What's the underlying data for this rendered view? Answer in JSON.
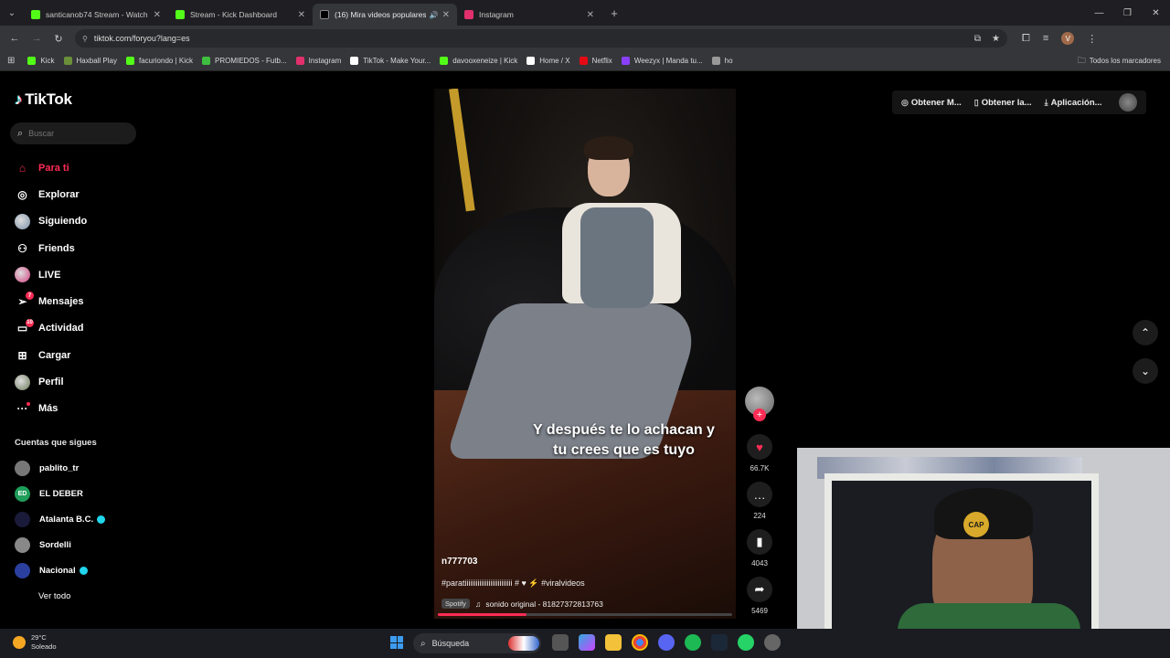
{
  "browser": {
    "tabs": [
      {
        "title": "santicanob74 Stream - Watch L",
        "color": "#53fc18",
        "active": false
      },
      {
        "title": "Stream - Kick Dashboard",
        "color": "#53fc18",
        "active": false
      },
      {
        "title": "(16) Mira videos populares",
        "color": "#ffffff",
        "active": true
      },
      {
        "title": "Instagram",
        "color": "#e1306c",
        "active": false
      }
    ],
    "url": "tiktok.com/foryou?lang=es",
    "bookmarks": [
      {
        "label": "Kick",
        "color": "#53fc18"
      },
      {
        "label": "Haxball Play",
        "color": "#6b8f3a"
      },
      {
        "label": "facuriondo | Kick",
        "color": "#53fc18"
      },
      {
        "label": "PROMIEDOS - Futb...",
        "color": "#3fbf3f"
      },
      {
        "label": "Instagram",
        "color": "#e1306c"
      },
      {
        "label": "TikTok - Make Your...",
        "color": "#ffffff"
      },
      {
        "label": "davooxeneize | Kick",
        "color": "#53fc18"
      },
      {
        "label": "Home / X",
        "color": "#ffffff"
      },
      {
        "label": "Netflix",
        "color": "#e50914"
      },
      {
        "label": "Weezyx | Manda tu...",
        "color": "#8a3ffc"
      },
      {
        "label": "ho",
        "color": "#999999"
      }
    ],
    "all_bookmarks": "Todos los marcadores"
  },
  "tiktok": {
    "logo": "TikTok",
    "search_placeholder": "Buscar",
    "menu": [
      {
        "label": "Para ti",
        "icon": "home-icon",
        "active": true
      },
      {
        "label": "Explorar",
        "icon": "compass-icon"
      },
      {
        "label": "Siguiendo",
        "icon": "avatar"
      },
      {
        "label": "Friends",
        "icon": "friends-icon"
      },
      {
        "label": "LIVE",
        "icon": "avatar"
      },
      {
        "label": "Mensajes",
        "icon": "send-icon",
        "badge": "7"
      },
      {
        "label": "Actividad",
        "icon": "inbox-icon",
        "badge": "10"
      },
      {
        "label": "Cargar",
        "icon": "upload-icon"
      },
      {
        "label": "Perfil",
        "icon": "avatar"
      },
      {
        "label": "Más",
        "icon": "more-icon",
        "dot": true
      }
    ],
    "following_title": "Cuentas que sigues",
    "following": [
      {
        "name": "pablito_tr",
        "verified": false,
        "color": "#777777",
        "initials": ""
      },
      {
        "name": "EL DEBER",
        "verified": false,
        "color": "#1e9e5a",
        "initials": "ED"
      },
      {
        "name": "Atalanta B.C.",
        "verified": true,
        "color": "#1a1a3a",
        "initials": ""
      },
      {
        "name": "Sordelli",
        "verified": false,
        "color": "#888888",
        "initials": ""
      },
      {
        "name": "Nacional",
        "verified": true,
        "color": "#2a3f9e",
        "initials": ""
      }
    ],
    "see_all": "Ver todo",
    "top_right": {
      "item1": "Obtener M...",
      "item2": "Obtener la...",
      "item3": "Aplicación..."
    }
  },
  "video": {
    "caption": "Y después te lo achacan y tu crees que es tuyo",
    "author": "n777703",
    "description": "#paratiiiiiiiiiiiiiiiiiiiiiiiiii # ♥ ⚡ #viralvideos",
    "spotify": "Spotify",
    "sound": "sonido original - 81827372813763",
    "progress": 0.3,
    "likes": "66.7K",
    "comments": "224",
    "saves": "4043",
    "shares": "5469"
  },
  "taskbar": {
    "temp": "29°C",
    "condition": "Soleado",
    "search": "Búsqueda"
  }
}
